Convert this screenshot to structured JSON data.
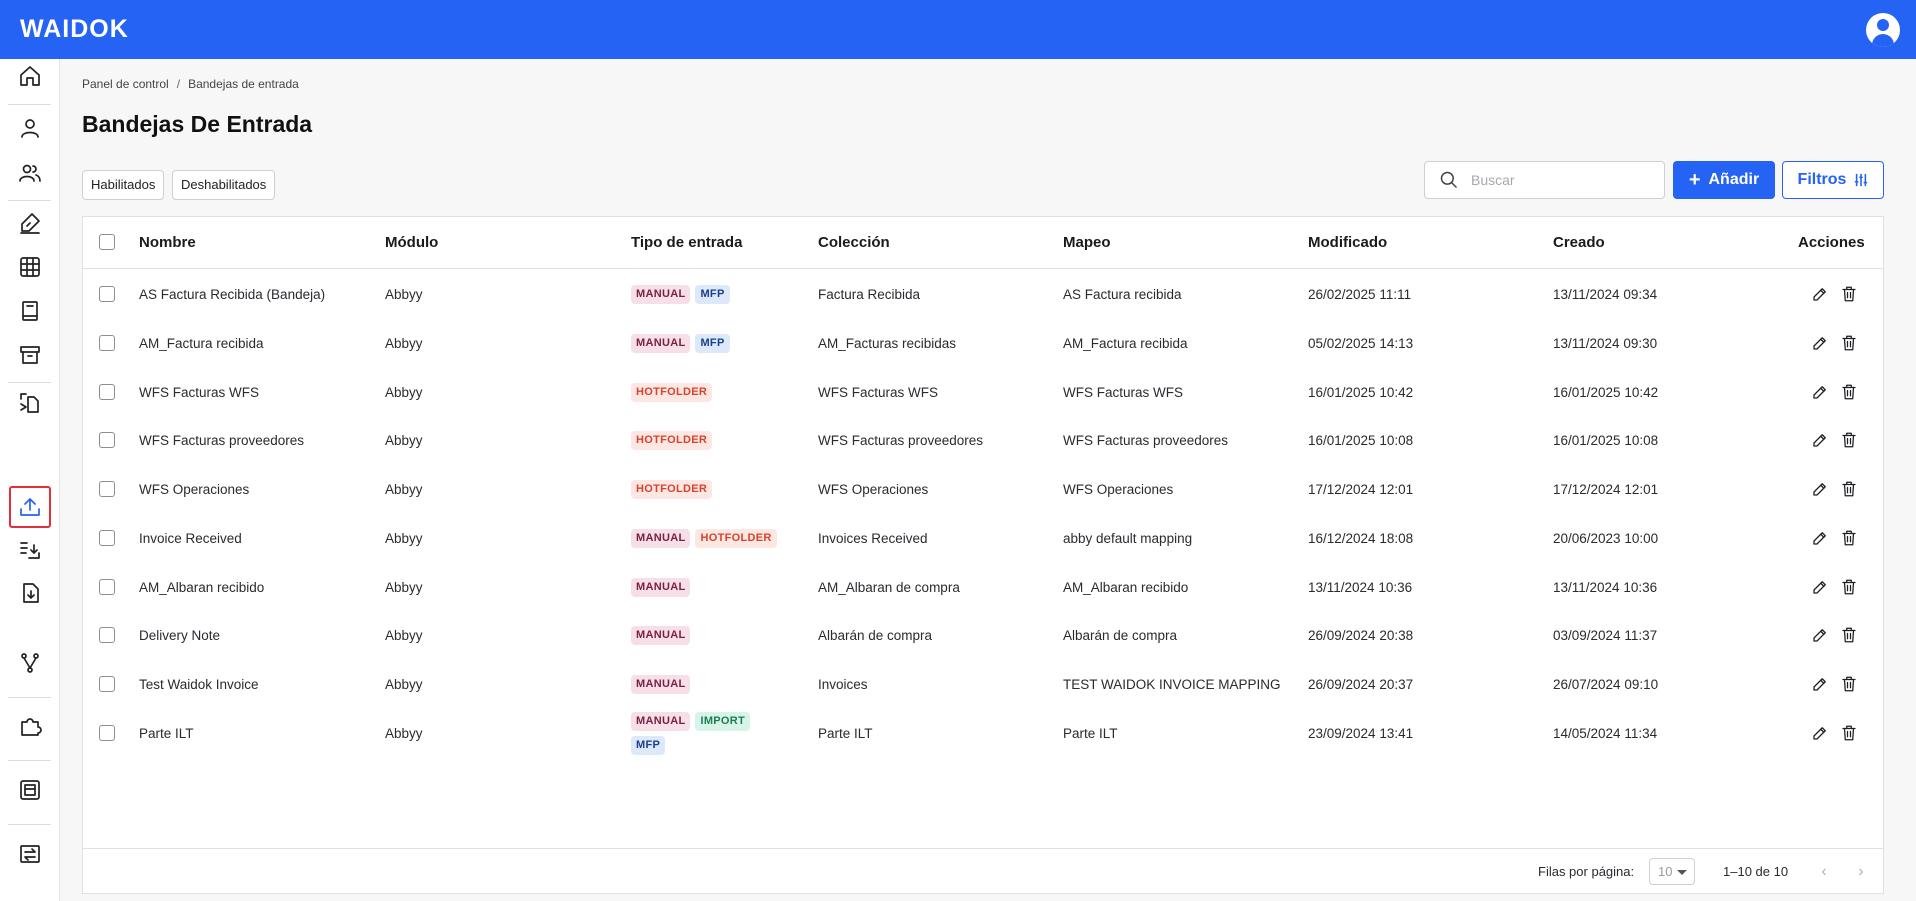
{
  "app": {
    "logo": "WAIDOK"
  },
  "breadcrumb": {
    "root": "Panel de control",
    "separator": "/",
    "current": "Bandejas de entrada"
  },
  "page": {
    "title": "Bandejas De Entrada"
  },
  "filters": {
    "enabled_label": "Habilitados",
    "disabled_label": "Deshabilitados"
  },
  "search": {
    "placeholder": "Buscar",
    "value": ""
  },
  "actions": {
    "add_label": "Añadir",
    "filters_label": "Filtros"
  },
  "table": {
    "columns": [
      "Nombre",
      "Módulo",
      "Tipo de entrada",
      "Colección",
      "Mapeo",
      "Modificado",
      "Creado",
      "Acciones"
    ],
    "rows": [
      {
        "name": "AS Factura Recibida (Bandeja)",
        "module": "Abbyy",
        "tags": [
          "MANUAL",
          "MFP"
        ],
        "collection": "Factura Recibida",
        "mapping": "AS Factura recibida",
        "modified": "26/02/2025 11:11",
        "created": "13/11/2024 09:34"
      },
      {
        "name": "AM_Factura recibida",
        "module": "Abbyy",
        "tags": [
          "MANUAL",
          "MFP"
        ],
        "collection": "AM_Facturas recibidas",
        "mapping": "AM_Factura recibida",
        "modified": "05/02/2025 14:13",
        "created": "13/11/2024 09:30"
      },
      {
        "name": "WFS Facturas WFS",
        "module": "Abbyy",
        "tags": [
          "HOTFOLDER"
        ],
        "collection": "WFS Facturas WFS",
        "mapping": "WFS Facturas WFS",
        "modified": "16/01/2025 10:42",
        "created": "16/01/2025 10:42"
      },
      {
        "name": "WFS Facturas proveedores",
        "module": "Abbyy",
        "tags": [
          "HOTFOLDER"
        ],
        "collection": "WFS Facturas proveedores",
        "mapping": "WFS Facturas proveedores",
        "modified": "16/01/2025 10:08",
        "created": "16/01/2025 10:08"
      },
      {
        "name": "WFS Operaciones",
        "module": "Abbyy",
        "tags": [
          "HOTFOLDER"
        ],
        "collection": "WFS Operaciones",
        "mapping": "WFS Operaciones",
        "modified": "17/12/2024 12:01",
        "created": "17/12/2024 12:01"
      },
      {
        "name": "Invoice Received",
        "module": "Abbyy",
        "tags": [
          "MANUAL",
          "HOTFOLDER"
        ],
        "collection": "Invoices Received",
        "mapping": "abby default mapping",
        "modified": "16/12/2024 18:08",
        "created": "20/06/2023 10:00"
      },
      {
        "name": "AM_Albaran recibido",
        "module": "Abbyy",
        "tags": [
          "MANUAL"
        ],
        "collection": "AM_Albaran de compra",
        "mapping": "AM_Albaran recibido",
        "modified": "13/11/2024 10:36",
        "created": "13/11/2024 10:36"
      },
      {
        "name": "Delivery Note",
        "module": "Abbyy",
        "tags": [
          "MANUAL"
        ],
        "collection": "Albarán de compra",
        "mapping": "Albarán de compra",
        "modified": "26/09/2024 20:38",
        "created": "03/09/2024 11:37"
      },
      {
        "name": "Test Waidok Invoice",
        "module": "Abbyy",
        "tags": [
          "MANUAL"
        ],
        "collection": "Invoices",
        "mapping": "TEST WAIDOK INVOICE MAPPING",
        "modified": "26/09/2024 20:37",
        "created": "26/07/2024 09:10"
      },
      {
        "name": "Parte ILT",
        "module": "Abbyy",
        "tags": [
          "MANUAL",
          "IMPORT",
          "MFP"
        ],
        "collection": "Parte ILT",
        "mapping": "Parte ILT",
        "modified": "23/09/2024 13:41",
        "created": "14/05/2024 11:34"
      }
    ]
  },
  "pagination": {
    "rows_per_page_label": "Filas por página:",
    "rows_per_page": "10",
    "range": "1–10 de 10"
  },
  "colors": {
    "primary": "#2563f5",
    "active_outline": "#e0303b"
  }
}
